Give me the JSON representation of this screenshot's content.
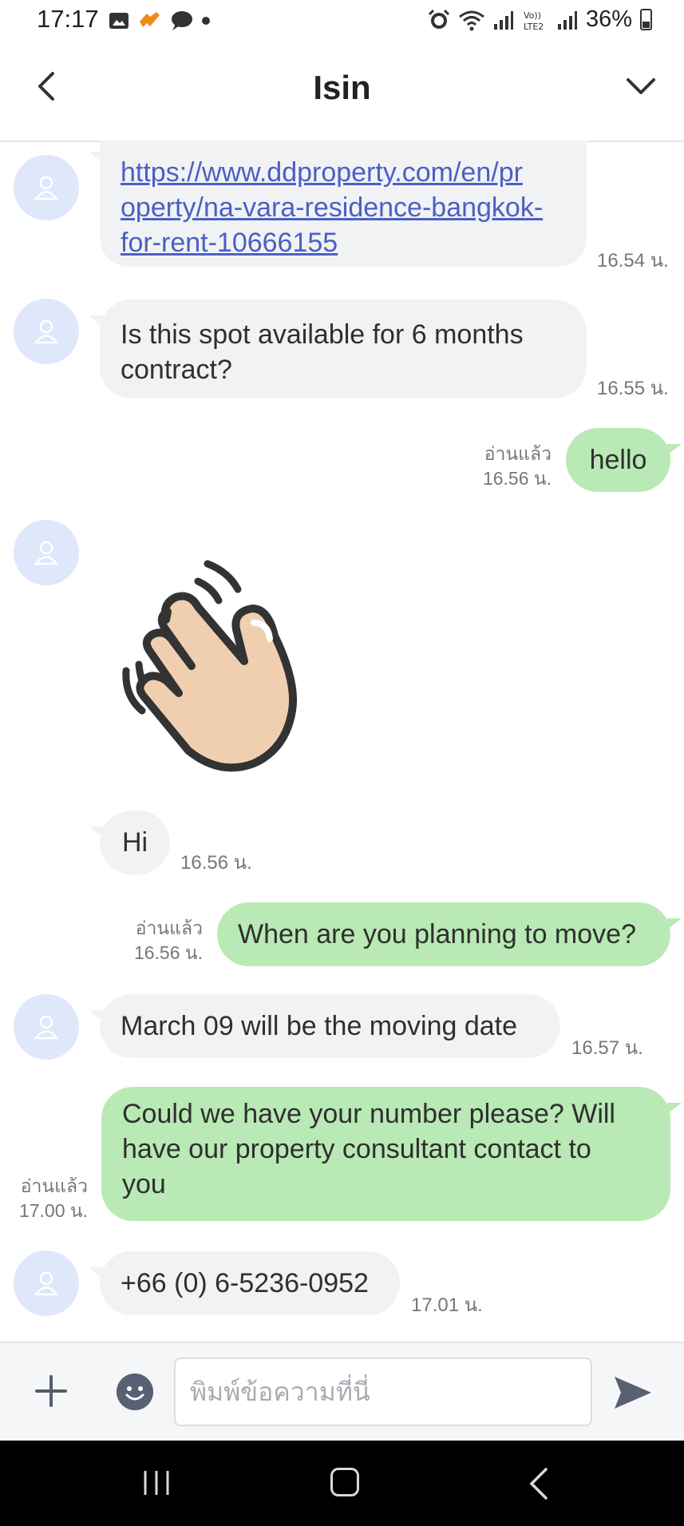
{
  "status_bar": {
    "time": "17:17",
    "battery": "36%"
  },
  "header": {
    "title": "Isin"
  },
  "messages": {
    "m1": {
      "lines": [
        "https://www.ddproperty.com/en/pr",
        "operty/na-vara-residence-bangkok-",
        "for-rent-10666155"
      ],
      "time": "16.54 น."
    },
    "m2": {
      "lines": [
        "Is this spot available for 6 months",
        "contract?"
      ],
      "time": "16.55 น."
    },
    "m3": {
      "text": "hello",
      "read": "อ่านแล้ว",
      "time": "16.56 น."
    },
    "m5": {
      "text": "Hi",
      "time": "16.56 น."
    },
    "m6": {
      "text": "When are you planning to move?",
      "read": "อ่านแล้ว",
      "time": "16.56 น."
    },
    "m7": {
      "text": "March 09 will be the moving date",
      "time": "16.57 น."
    },
    "m8": {
      "lines": [
        "Could we have your number please? Will",
        "have our property consultant contact to",
        "you"
      ],
      "read": "อ่านแล้ว",
      "time": "17.00 น."
    },
    "m9": {
      "text": "+66 (0) 6-5236-0952",
      "time": "17.01 น."
    }
  },
  "input": {
    "placeholder": "พิมพ์ข้อความที่นี่"
  },
  "icons": {
    "back": "chevron-left-icon",
    "menu": "chevron-down-icon",
    "avatar": "person-icon",
    "sticker": "waving-hand-icon",
    "plus": "plus-icon",
    "emoji": "emoji-icon",
    "send": "send-icon"
  },
  "colors": {
    "outgoing_bubble": "#b9e9b4",
    "incoming_bubble": "#f1f2f4",
    "link": "#4a60c6",
    "avatar_bg": "#dfe7fb"
  }
}
